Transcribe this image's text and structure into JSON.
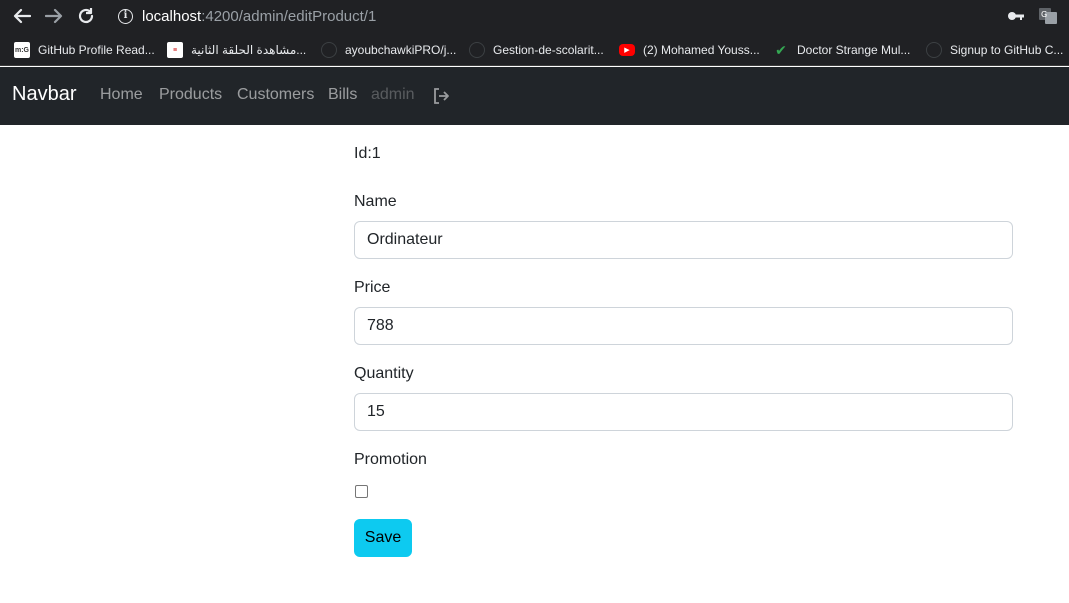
{
  "browser": {
    "url_host": "localhost",
    "url_path": ":4200/admin/editProduct/1",
    "bookmarks": [
      {
        "label": "GitHub Profile Read...",
        "icon": "mg-favicon"
      },
      {
        "label": "مشاهدة الحلقة الثانية...",
        "icon": "site-favicon"
      },
      {
        "label": "ayoubchawkiPRO/j...",
        "icon": "github-icon"
      },
      {
        "label": "Gestion-de-scolarit...",
        "icon": "github-icon"
      },
      {
        "label": "(2) Mohamed Youss...",
        "icon": "youtube-icon"
      },
      {
        "label": "Doctor Strange Mul...",
        "icon": "check-icon"
      },
      {
        "label": "Signup to GitHub C...",
        "icon": "github-icon"
      }
    ]
  },
  "navbar": {
    "brand": "Navbar",
    "links": [
      "Home",
      "Products",
      "Customers",
      "Bills"
    ],
    "user": "admin"
  },
  "form": {
    "id_label": "Id:1",
    "name_label": "Name",
    "name_value": "Ordinateur",
    "price_label": "Price",
    "price_value": "788",
    "quantity_label": "Quantity",
    "quantity_value": "15",
    "promotion_label": "Promotion",
    "promotion_checked": false,
    "save_label": "Save"
  },
  "colors": {
    "navbar_bg": "#212529",
    "save_button": "#0dcaf0"
  }
}
